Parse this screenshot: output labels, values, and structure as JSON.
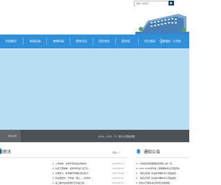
{
  "header": {
    "search_placeholder": "请输入关键词"
  },
  "nav": {
    "items": [
      {
        "label": "学校概况"
      },
      {
        "label": "新闻动态"
      },
      {
        "label": "教育科研"
      },
      {
        "label": "德育活动"
      },
      {
        "label": "招生就业"
      },
      {
        "label": "团学园"
      },
      {
        "label": "招生指导"
      },
      {
        "label": "后勤服务"
      },
      {
        "label": "小学校"
      }
    ]
  },
  "banner": {
    "label": "所在位置",
    "title": "2016—2022（下）新中大赛新闻展"
  },
  "news": {
    "title": "新闻资讯",
    "more": "更多>>",
    "items": [
      {
        "text": "入学指南：新学年丰富多彩的新闻...",
        "date": "2021/03/15"
      },
      {
        "text": "弘扬工匠精神：最新学年进行文艺比...",
        "date": "2021/03/10"
      },
      {
        "text": "文明学子：新学期开学典礼暨表彰大...",
        "date": "2021/03/08"
      },
      {
        "text": "新生报到时，开学第一课之——新学年...",
        "date": "2021/03/01"
      },
      {
        "text": "第三届学生技能展示及作品汇报...",
        "date": "2021/02/27"
      }
    ]
  },
  "notice": {
    "title": "通知公告",
    "items": [
      {
        "text": "八新地区区教课题结项通知公告一览..."
      },
      {
        "text": "2021-2022学年第二学期期末考试日程安排..."
      },
      {
        "text": "【招生咨询】欢迎新学期新学子莅临报名..."
      },
      {
        "text": "【招生宣传】欢迎新学期新学子莅临报名..."
      },
      {
        "text": "学校关于期末考试安排及放假通知..."
      }
    ]
  },
  "colors": {
    "nav": "#2f8fd8",
    "hero": "#b9def3",
    "banner": "#4b5154",
    "accent": "#2f8fd8"
  }
}
